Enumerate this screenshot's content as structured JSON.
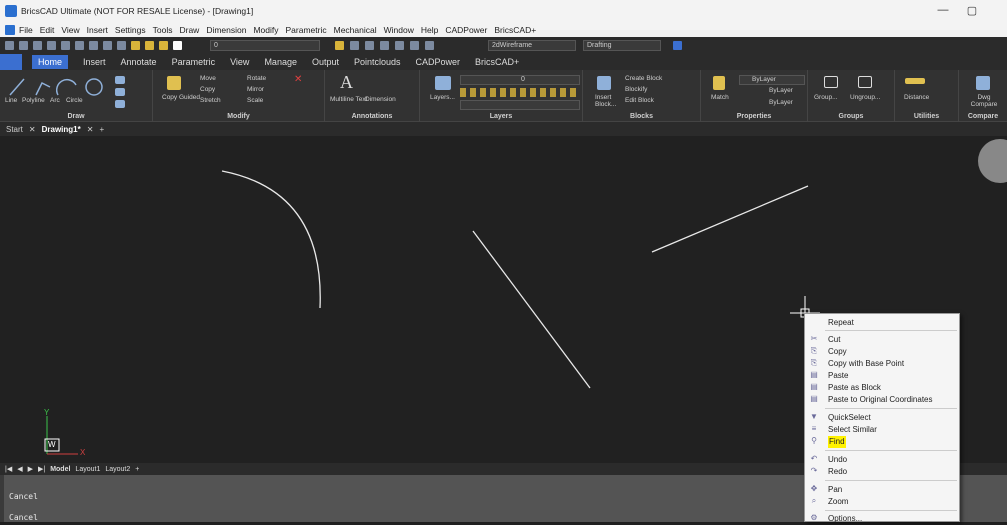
{
  "window": {
    "title": "BricsCAD Ultimate (NOT FOR RESALE License) - [Drawing1]",
    "minimize": "—",
    "restore": "▢"
  },
  "menubar": [
    "File",
    "Edit",
    "View",
    "Insert",
    "Settings",
    "Tools",
    "Draw",
    "Dimension",
    "Modify",
    "Parametric",
    "Mechanical",
    "Window",
    "Help",
    "CADPower",
    "BricsCAD+"
  ],
  "quickaccess": {
    "layer_value": "0",
    "visual_style": "2dWireframe",
    "workspace": "Drafting"
  },
  "ribbon_tabs": [
    "Home",
    "Insert",
    "Annotate",
    "Parametric",
    "View",
    "Manage",
    "Output",
    "Pointclouds",
    "CADPower",
    "BricsCAD+"
  ],
  "ribbon": {
    "draw": {
      "title": "Draw",
      "tools": [
        "Line",
        "Polyline",
        "Arc",
        "Circle"
      ]
    },
    "modify": {
      "title": "Modify",
      "tools": [
        "Copy Guided",
        "Move",
        "Copy",
        "Stretch",
        "Rotate",
        "Mirror",
        "Scale"
      ]
    },
    "annotations": {
      "title": "Annotations",
      "tools": [
        "Multiline Text",
        "Dimension"
      ]
    },
    "layers": {
      "title": "Layers",
      "tools": [
        "Layers...",
        "0"
      ]
    },
    "blocks": {
      "title": "Blocks",
      "tools": [
        "Insert Block...",
        "Create Block",
        "Blockify",
        "Edit Block"
      ]
    },
    "properties": {
      "title": "Properties",
      "tools": [
        "Match",
        "ByLayer",
        "ByLayer",
        "ByLayer"
      ]
    },
    "groups": {
      "title": "Groups",
      "tools": [
        "Group...",
        "Ungroup..."
      ]
    },
    "utilities": {
      "title": "Utilities",
      "tools": [
        "Distance"
      ]
    },
    "compare": {
      "title": "Compare",
      "tools": [
        "Dwg Compare"
      ]
    }
  },
  "doc_tabs": [
    "Start",
    "Drawing1*"
  ],
  "layout_tabs": [
    "Model",
    "Layout1",
    "Layout2"
  ],
  "ucs": {
    "x": "X",
    "y": "Y",
    "w": "W"
  },
  "command_history": [
    "Cancel",
    "Cancel"
  ],
  "context_menu": [
    {
      "label": "Repeat",
      "icon": ""
    },
    {
      "label": "Cut",
      "icon": "✂"
    },
    {
      "label": "Copy",
      "icon": "⎘"
    },
    {
      "label": "Copy with Base Point",
      "icon": "⎘"
    },
    {
      "label": "Paste",
      "icon": "▤"
    },
    {
      "label": "Paste as Block",
      "icon": "▤"
    },
    {
      "label": "Paste to Original Coordinates",
      "icon": "▤"
    },
    {
      "label": "QuickSelect",
      "icon": "▼"
    },
    {
      "label": "Select Similar",
      "icon": "≡"
    },
    {
      "label": "Find",
      "icon": "⚲",
      "highlight": true
    },
    {
      "label": "Undo",
      "icon": "↶"
    },
    {
      "label": "Redo",
      "icon": "↷"
    },
    {
      "label": "Pan",
      "icon": "✥"
    },
    {
      "label": "Zoom",
      "icon": "⌕"
    },
    {
      "label": "Options...",
      "icon": "⚙"
    }
  ],
  "colors": {
    "ribbon_accent": "#3b6fd0",
    "find_highlight": "#fff200",
    "canvas": "#212121"
  }
}
